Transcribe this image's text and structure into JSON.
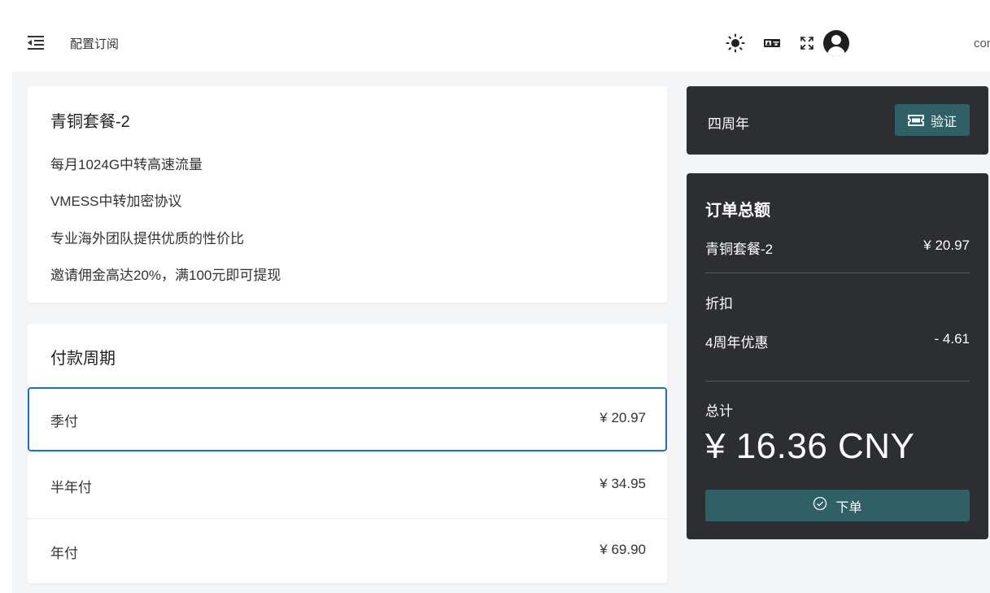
{
  "header": {
    "title": "配置订阅",
    "email_suffix": "com",
    "icons": [
      "menu-toggle-icon",
      "sun-icon",
      "translate-icon",
      "fullscreen-icon",
      "user-avatar-icon"
    ]
  },
  "plan": {
    "name": "青铜套餐-2",
    "features": [
      "每月1024G中转高速流量",
      "VMESS中转加密协议",
      "专业海外团队提供优质的性价比",
      "邀请佣金高达20%，满100元即可提现"
    ]
  },
  "period": {
    "title": "付款周期",
    "options": [
      {
        "label": "季付",
        "price": "¥ 20.97",
        "selected": true
      },
      {
        "label": "半年付",
        "price": "¥ 34.95",
        "selected": false
      },
      {
        "label": "年付",
        "price": "¥ 69.90",
        "selected": false
      }
    ]
  },
  "coupon": {
    "code": "四周年",
    "verify_label": "验证"
  },
  "summary": {
    "title": "订单总额",
    "plan_name": "青铜套餐-2",
    "plan_price": "¥ 20.97",
    "discount_label": "折扣",
    "discount_name": "4周年优惠",
    "discount_value": "- 4.61",
    "total_label": "总计",
    "total_amount": "¥ 16.36 CNY",
    "order_label": "下单"
  },
  "colors": {
    "accent_teal": "#2f6066",
    "selected_border": "#1f6fc9",
    "dark_card": "#2d2e31",
    "page_bg": "#f4f5f7"
  }
}
